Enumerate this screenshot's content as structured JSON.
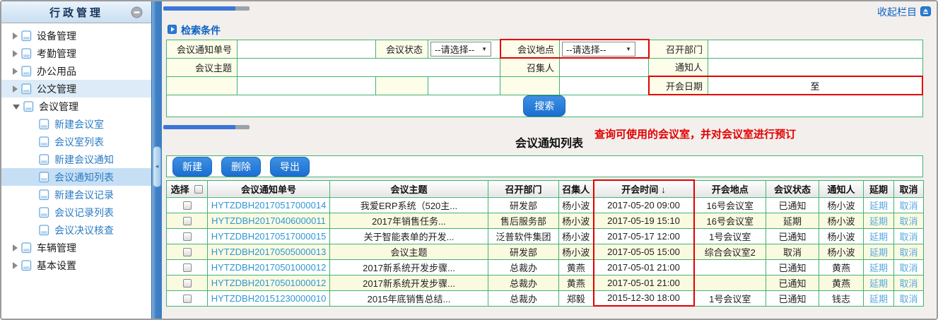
{
  "colors": {
    "accent_blue": "#1d7dd8",
    "table_border_green": "#42b373",
    "highlight_red": "#e30000",
    "notice_link_blue": "#2f96d6",
    "action_link_blue": "#58a8e0",
    "label_cell_yellow": "#fdfdea",
    "alt_row_yellow": "#fafae0",
    "splitter_blue": "#3e7ec2",
    "sidebar_header_blue": "#c9dff2"
  },
  "sidebar": {
    "title": "行政管理",
    "items": [
      {
        "name": "equipment",
        "label": "设备管理",
        "level": 1,
        "state": "collapsed"
      },
      {
        "name": "attendance",
        "label": "考勤管理",
        "level": 1,
        "state": "collapsed"
      },
      {
        "name": "office-supplies",
        "label": "办公用品",
        "level": 1,
        "state": "collapsed"
      },
      {
        "name": "documents",
        "label": "公文管理",
        "level": 1,
        "state": "collapsed",
        "hover": true
      },
      {
        "name": "meetings",
        "label": "会议管理",
        "level": 1,
        "state": "expanded"
      },
      {
        "name": "new-meeting-room",
        "label": "新建会议室",
        "level": 2
      },
      {
        "name": "meeting-room-list",
        "label": "会议室列表",
        "level": 2
      },
      {
        "name": "new-meeting-notice",
        "label": "新建会议通知",
        "level": 2
      },
      {
        "name": "meeting-notice-list",
        "label": "会议通知列表",
        "level": 2,
        "selected": true
      },
      {
        "name": "new-meeting-record",
        "label": "新建会议记录",
        "level": 2
      },
      {
        "name": "meeting-record-list",
        "label": "会议记录列表",
        "level": 2
      },
      {
        "name": "meeting-resolution-check",
        "label": "会议决议核查",
        "level": 2
      },
      {
        "name": "vehicles",
        "label": "车辆管理",
        "level": 1,
        "state": "collapsed"
      },
      {
        "name": "basic-settings",
        "label": "基本设置",
        "level": 1,
        "state": "collapsed"
      }
    ]
  },
  "topbar": {
    "collapse_label": "收起栏目"
  },
  "search": {
    "section_title": "检索条件",
    "labels": {
      "notice_no": "会议通知单号",
      "status": "会议状态",
      "place": "会议地点",
      "dept": "召开部门",
      "subject": "会议主题",
      "convener": "召集人",
      "notifier": "通知人",
      "date": "开会日期"
    },
    "select_placeholder": "--请选择--",
    "date_separator": "至",
    "search_button": "搜索"
  },
  "list": {
    "title": "会议通知列表",
    "annotation": "查询可使用的会议室，并对会议室进行预订",
    "toolbar": [
      {
        "name": "new",
        "label": "新建"
      },
      {
        "name": "delete",
        "label": "删除"
      },
      {
        "name": "export",
        "label": "导出"
      }
    ],
    "columns": [
      "选择",
      "会议通知单号",
      "会议主题",
      "召开部门",
      "召集人",
      "开会时间",
      "开会地点",
      "会议状态",
      "通知人",
      "延期",
      "取消"
    ],
    "sort_arrow": "↓",
    "rows": [
      {
        "no": "HYTZDBH20170517000014",
        "subject": "我爱ERP系统（520主...",
        "dept": "研发部",
        "convener": "杨小波",
        "time": "2017-05-20 09:00",
        "place": "16号会议室",
        "status": "已通知",
        "notifier": "杨小波",
        "delay": "延期",
        "cancel": "取消"
      },
      {
        "no": "HYTZDBH20170406000011",
        "subject": "2017年销售任务...",
        "dept": "售后服务部",
        "convener": "杨小波",
        "time": "2017-05-19 15:10",
        "place": "16号会议室",
        "status": "延期",
        "notifier": "杨小波",
        "delay": "延期",
        "cancel": "取消"
      },
      {
        "no": "HYTZDBH20170517000015",
        "subject": "关于智能表单的开发...",
        "dept": "泛普软件集团",
        "convener": "杨小波",
        "time": "2017-05-17 12:00",
        "place": "1号会议室",
        "status": "已通知",
        "notifier": "杨小波",
        "delay": "延期",
        "cancel": "取消"
      },
      {
        "no": "HYTZDBH20170505000013",
        "subject": "会议主题",
        "dept": "研发部",
        "convener": "杨小波",
        "time": "2017-05-05 15:00",
        "place": "综合会议室2",
        "status": "取消",
        "notifier": "杨小波",
        "delay": "延期",
        "cancel": "取消"
      },
      {
        "no": "HYTZDBH20170501000012",
        "subject": "2017新系统开发步骤...",
        "dept": "总裁办",
        "convener": "黄燕",
        "time": "2017-05-01 21:00",
        "place": "",
        "status": "已通知",
        "notifier": "黄燕",
        "delay": "延期",
        "cancel": "取消"
      },
      {
        "no": "HYTZDBH20170501000012",
        "subject": "2017新系统开发步骤...",
        "dept": "总裁办",
        "convener": "黄燕",
        "time": "2017-05-01 21:00",
        "place": "",
        "status": "已通知",
        "notifier": "黄燕",
        "delay": "延期",
        "cancel": "取消"
      },
      {
        "no": "HYTZDBH20151230000010",
        "subject": "2015年底销售总结...",
        "dept": "总裁办",
        "convener": "郑毅",
        "time": "2015-12-30 18:00",
        "place": "1号会议室",
        "status": "已通知",
        "notifier": "钱志",
        "delay": "延期",
        "cancel": "取消"
      }
    ]
  }
}
